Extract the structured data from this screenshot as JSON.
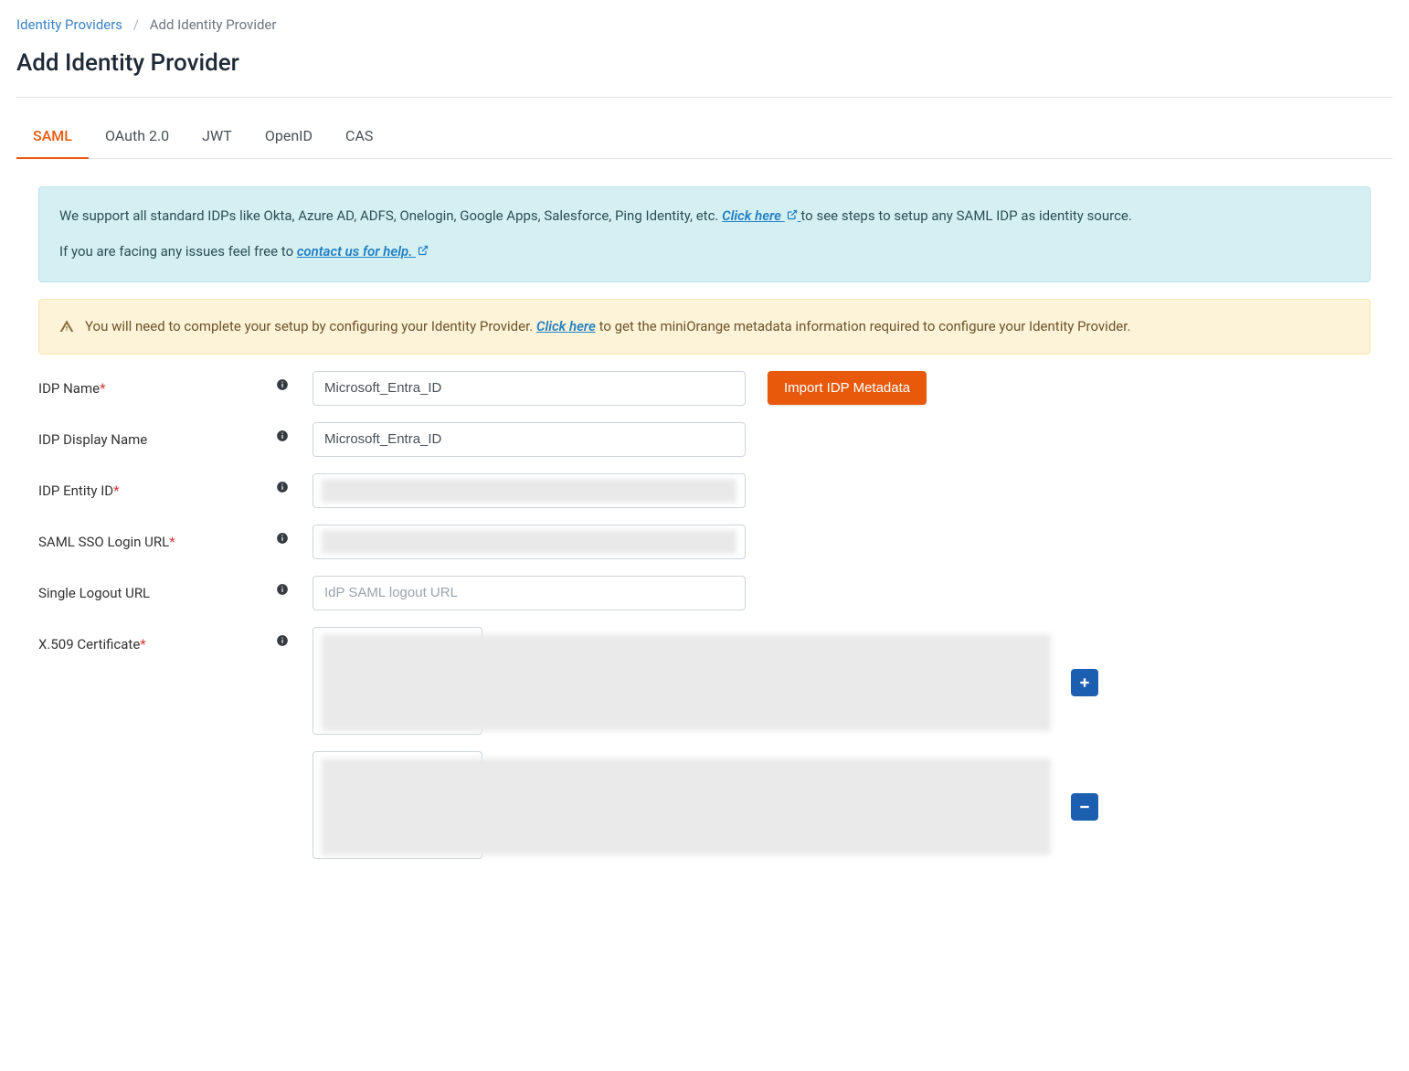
{
  "breadcrumb": {
    "root": "Identity Providers",
    "current": "Add Identity Provider"
  },
  "page_title": "Add Identity Provider",
  "tabs": [
    {
      "label": "SAML",
      "active": true
    },
    {
      "label": "OAuth 2.0",
      "active": false
    },
    {
      "label": "JWT",
      "active": false
    },
    {
      "label": "OpenID",
      "active": false
    },
    {
      "label": "CAS",
      "active": false
    }
  ],
  "info_alert": {
    "line1_pre": "We support all standard IDPs like Okta, Azure AD, ADFS, Onelogin, Google Apps, Salesforce, Ping Identity, etc. ",
    "line1_link": "Click here",
    "line1_post": " to see steps to setup any SAML IDP as identity source.",
    "line2_pre": "If you are facing any issues feel free to ",
    "line2_link": "contact us for help."
  },
  "warning_alert": {
    "pre": "You will need to complete your setup by configuring your Identity Provider. ",
    "link": "Click here",
    "post": " to get the miniOrange metadata information required to configure your Identity Provider."
  },
  "form": {
    "idp_name_label": "IDP Name",
    "idp_name_value": "Microsoft_Entra_ID",
    "import_button": "Import IDP Metadata",
    "idp_display_label": "IDP Display Name",
    "idp_display_value": "Microsoft_Entra_ID",
    "idp_entity_label": "IDP Entity ID",
    "idp_entity_value": "",
    "sso_url_label": "SAML SSO Login URL",
    "sso_url_value": "",
    "slo_url_label": "Single Logout URL",
    "slo_url_placeholder": "IdP SAML logout URL",
    "cert_label": "X.509 Certificate"
  }
}
